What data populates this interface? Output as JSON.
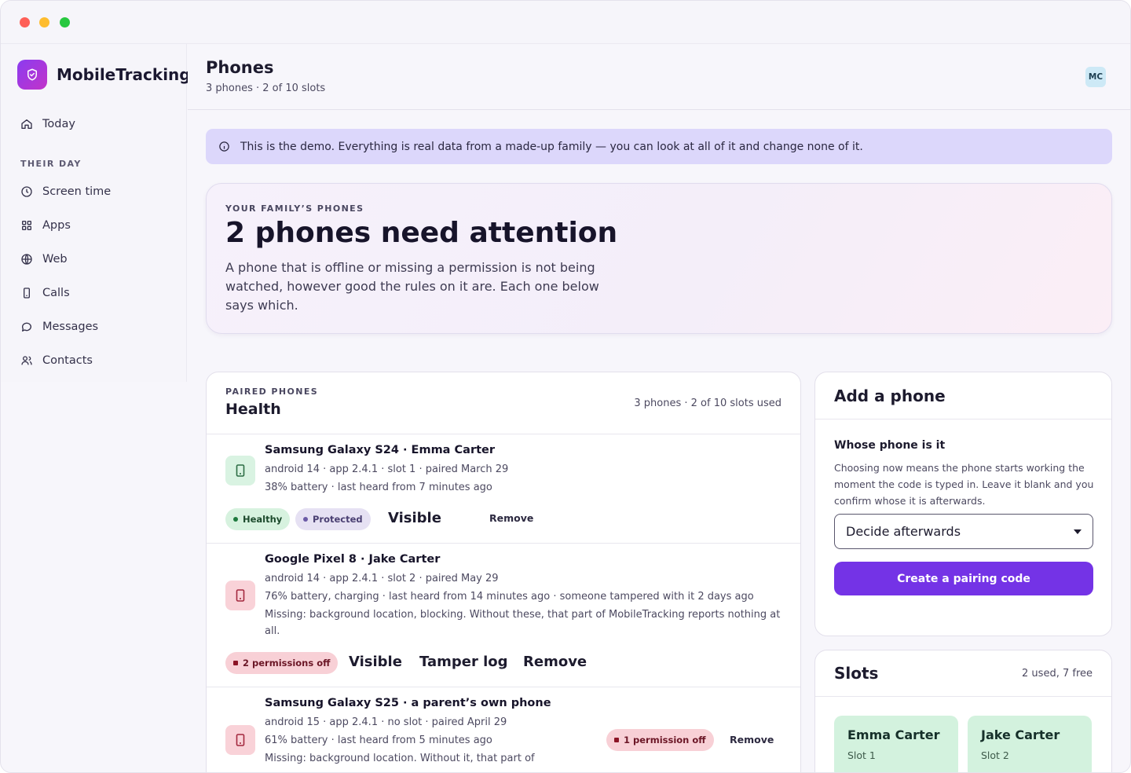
{
  "app": {
    "name": "MobileTracking"
  },
  "sidebar": {
    "today": "Today",
    "section_label": "THEIR DAY",
    "items": [
      {
        "label": "Screen time",
        "icon": "clock-icon"
      },
      {
        "label": "Apps",
        "icon": "apps-grid-icon"
      },
      {
        "label": "Web",
        "icon": "globe-icon"
      },
      {
        "label": "Calls",
        "icon": "phone-icon"
      },
      {
        "label": "Messages",
        "icon": "message-bubble-icon"
      },
      {
        "label": "Contacts",
        "icon": "contacts-icon"
      }
    ]
  },
  "header": {
    "title": "Phones",
    "subtitle": "3 phones · 2 of 10 slots",
    "avatar_initials": "MC"
  },
  "banner": {
    "text": "This is the demo. Everything is real data from a made-up family — you can look at all of it and change none of it."
  },
  "hero": {
    "eyebrow": "YOUR FAMILY’S PHONES",
    "title": "2 phones need attention",
    "text": "A phone that is offline or missing a permission is not being watched, however good the rules on it are. Each one below says which."
  },
  "phones": {
    "eyebrow": "PAIRED PHONES",
    "title": "Health",
    "count": "3 phones · 2 of 10 slots used",
    "rows": [
      {
        "name": "Samsung Galaxy S24 · Emma Carter",
        "meta1": "android 14 · app 2.4.1 · slot 1 · paired March 29",
        "meta2": "38% battery · last heard from 7 minutes ago",
        "status": "healthy",
        "pill_healthy": "Healthy",
        "pill_protected": "Protected",
        "action_visible": "Visible",
        "action_remove": "Remove"
      },
      {
        "name": "Google Pixel 8 · Jake Carter",
        "meta1": "android 14 · app 2.4.1 · slot 2 · paired May 29",
        "meta2": "76% battery, charging · last heard from 14 minutes ago · someone tampered with it 2 days ago",
        "meta3": "Missing: background location, blocking. Without these, that part of MobileTracking reports nothing at all.",
        "status": "warning",
        "pill_permissions": "2 permissions off",
        "action_visible": "Visible",
        "action_tamper": "Tamper log",
        "action_remove": "Remove"
      },
      {
        "name": "Samsung Galaxy S25 · a parent’s own phone",
        "meta1": "android 15 · app 2.4.1 · no slot · paired April 29",
        "meta2": "61% battery · last heard from 5 minutes ago",
        "meta3": "Missing: background location. Without it, that part of",
        "status": "warning",
        "pill_permissions": "1 permission off",
        "action_remove": "Remove"
      }
    ]
  },
  "add_phone": {
    "title": "Add a phone",
    "label": "Whose phone is it",
    "help": "Choosing now means the phone starts working the moment the code is typed in. Leave it blank and you confirm whose it is afterwards.",
    "select_value": "Decide afterwards",
    "button": "Create a pairing code"
  },
  "slots": {
    "title": "Slots",
    "count": "2 used, 7 free",
    "items": [
      {
        "name": "Emma Carter",
        "slot": "Slot 1"
      },
      {
        "name": "Jake Carter",
        "slot": "Slot 2"
      }
    ]
  },
  "colors": {
    "accent": "#7433e6",
    "banner": "#dcd7fb",
    "healthy": "#d7f2df",
    "warning": "#f8d0d6"
  }
}
